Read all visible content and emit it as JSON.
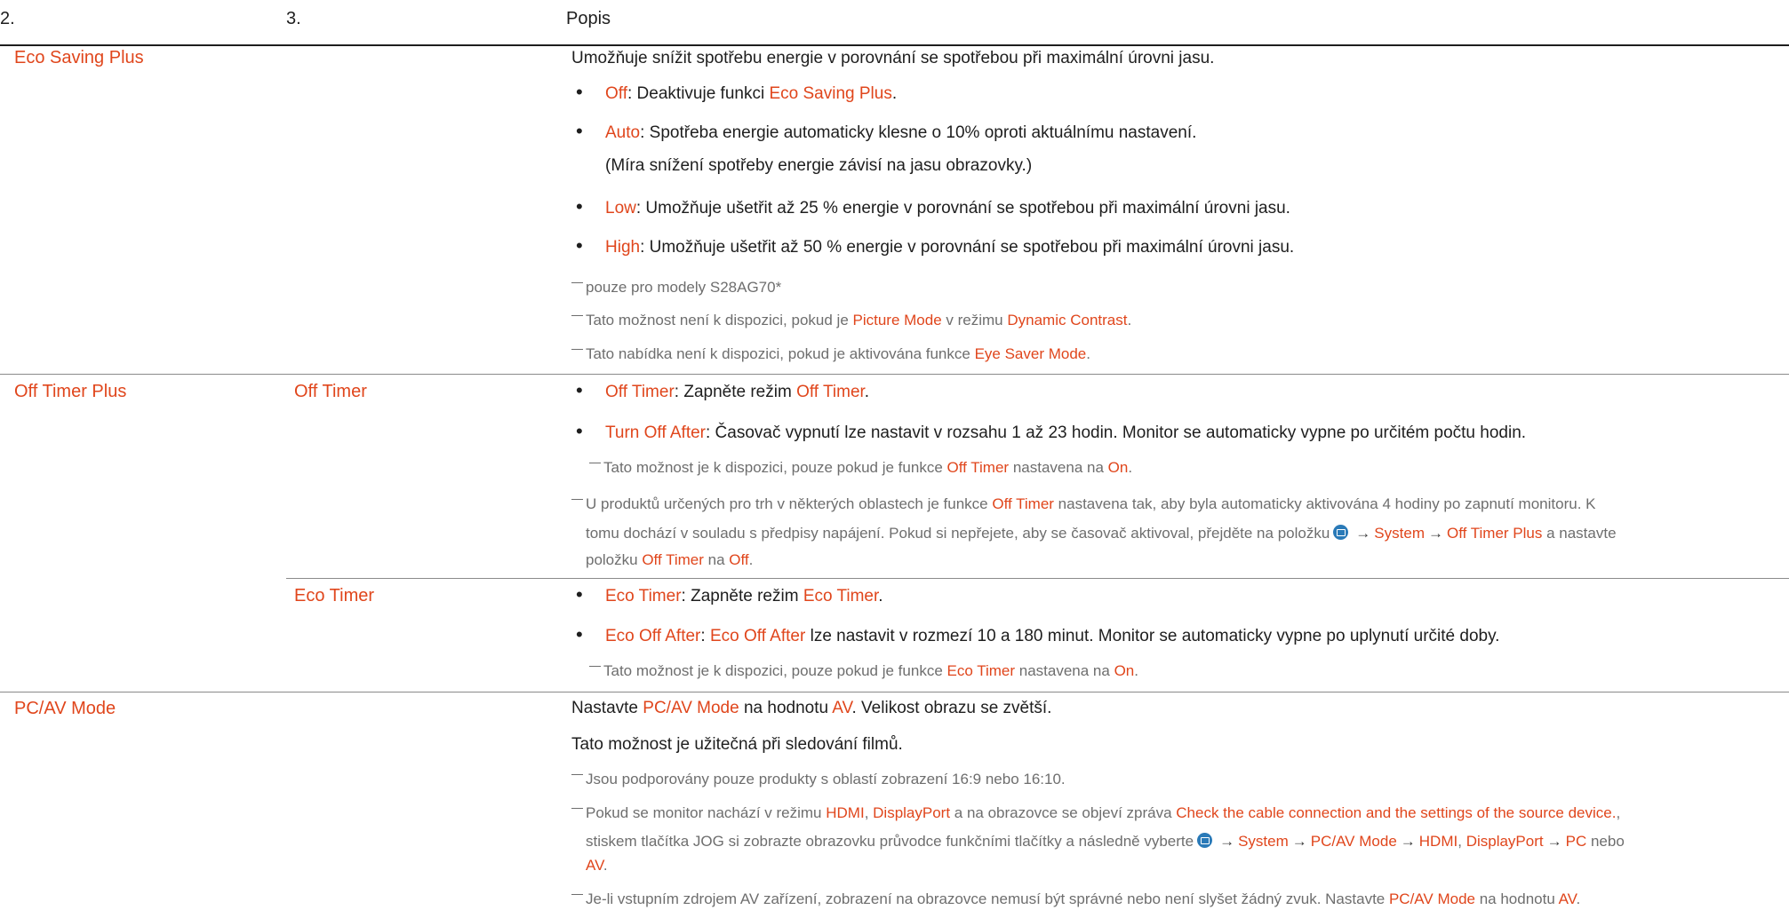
{
  "header": {
    "col1": "2.",
    "col2": "3.",
    "col3": "Popis"
  },
  "eco_saving": {
    "label": "Eco Saving Plus",
    "intro": "Umožňuje snížit spotřebu energie v porovnání se spotřebou při maximální úrovni jasu.",
    "off_key": "Off",
    "off_text": ": Deaktivuje funkci ",
    "off_ref": "Eco Saving Plus",
    "off_end": ".",
    "auto_key": "Auto",
    "auto_text": ": Spotřeba energie automaticky klesne o 10% oproti aktuálnímu nastavení.",
    "auto_note": "(Míra snížení spotřeby energie závisí na jasu obrazovky.)",
    "low_key": "Low",
    "low_text": ": Umožňuje ušetřit až 25 % energie v porovnání se spotřebou při maximální úrovni jasu.",
    "high_key": "High",
    "high_text": ": Umožňuje ušetřit až 50 % energie v porovnání se spotřebou při maximální úrovni jasu.",
    "note1": "pouze pro modely S28AG70*",
    "note2_a": "Tato možnost není k dispozici, pokud je ",
    "note2_b": "Picture Mode",
    "note2_c": " v režimu ",
    "note2_d": "Dynamic Contrast",
    "note2_e": ".",
    "note3_a": "Tato nabídka není k dispozici, pokud je aktivována funkce ",
    "note3_b": "Eye Saver Mode",
    "note3_c": "."
  },
  "off_timer_plus": {
    "label": "Off Timer Plus",
    "sub_label": "Off Timer",
    "b1_key": "Off Timer",
    "b1_text": ": Zapněte režim ",
    "b1_ref": "Off Timer",
    "b1_end": ".",
    "b2_key": "Turn Off After",
    "b2_text": ": Časovač vypnutí lze nastavit v rozsahu 1 až 23 hodin. Monitor se automaticky vypne po určitém počtu hodin.",
    "subnote_a": "Tato možnost je k dispozici, pouze pokud je funkce ",
    "subnote_b": "Off Timer",
    "subnote_c": " nastavena na ",
    "subnote_d": "On",
    "subnote_e": ".",
    "note_l1_a": "U produktů určených pro trh v některých oblastech je funkce ",
    "note_l1_b": "Off Timer",
    "note_l1_c": " nastavena tak, aby byla automaticky aktivována 4 hodiny po zapnutí monitoru. K",
    "note_l2_a": "tomu dochází v souladu s předpisy napájení. Pokud si nepřejete, aby se časovač aktivoval, přejděte na položku",
    "note_l2_arrow": "→",
    "note_l2_b": "System",
    "note_l2_c": "Off Timer Plus",
    "note_l2_d": " a nastavte",
    "note_l3_a": "položku ",
    "note_l3_b": "Off Timer",
    "note_l3_c": " na ",
    "note_l3_d": "Off",
    "note_l3_e": "."
  },
  "eco_timer": {
    "sub_label": "Eco Timer",
    "b1_key": "Eco Timer",
    "b1_text": ": Zapněte režim ",
    "b1_ref": "Eco Timer",
    "b1_end": ".",
    "b2_key": "Eco Off After",
    "b2_text": ": ",
    "b2_ref": "Eco Off After",
    "b2_rest": " lze nastavit v rozmezí 10 a 180 minut. Monitor se automaticky vypne po uplynutí určité doby.",
    "subnote_a": "Tato možnost je k dispozici, pouze pokud je funkce ",
    "subnote_b": "Eco Timer",
    "subnote_c": " nastavena na ",
    "subnote_d": "On",
    "subnote_e": "."
  },
  "pc_av": {
    "label": "PC/AV Mode",
    "l1_a": "Nastavte ",
    "l1_b": "PC/AV Mode",
    "l1_c": " na hodnotu ",
    "l1_d": "AV",
    "l1_e": ". Velikost obrazu se zvětší.",
    "l2": "Tato možnost je užitečná při sledování filmů.",
    "note1": "Jsou podporovány pouze produkty s oblastí zobrazení 16:9 nebo 16:10.",
    "note2_l1_a": "Pokud se monitor nachází v režimu ",
    "note2_l1_b": "HDMI",
    "note2_l1_c": ", ",
    "note2_l1_d": "DisplayPort",
    "note2_l1_e": " a na obrazovce se objeví zpráva ",
    "note2_l1_f": "Check the cable connection and the settings of the source device.",
    "note2_l1_g": ",",
    "note2_l2_a": "stiskem tlačítka JOG si zobrazte obrazovku průvodce funkčními tlačítky a následně vyberte",
    "note2_l2_b": "System",
    "note2_l2_c": "PC/AV Mode",
    "note2_l2_d": "HDMI",
    "note2_l2_e": ", ",
    "note2_l2_f": "DisplayPort",
    "note2_l2_g": "PC",
    "note2_l2_h": " nebo",
    "note2_l3_a": "AV",
    "note2_l3_b": ".",
    "note3_a": "Je-li vstupním zdrojem AV zařízení, zobrazení na obrazovce nemusí být správné nebo není slyšet žádný zvuk. Nastavte ",
    "note3_b": "PC/AV Mode",
    "note3_c": " na hodnotu ",
    "note3_d": "AV",
    "note3_e": "."
  }
}
